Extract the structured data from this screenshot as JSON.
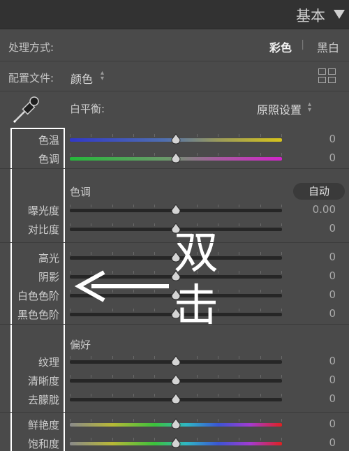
{
  "header": {
    "title": "基本",
    "collapse_icon": "triangle-down-icon"
  },
  "treatment": {
    "label": "处理方式:",
    "color_option": "彩色",
    "separator": "|",
    "bw_option": "黑白"
  },
  "profile": {
    "label": "配置文件:",
    "value": "颜色",
    "stepper": "⌃⌄",
    "browser_icon": "grid-icon"
  },
  "white_balance": {
    "icon": "eyedropper-icon",
    "label": "白平衡:",
    "value": "原照设置",
    "stepper": "⌃⌄"
  },
  "sliders_wb": [
    {
      "label": "色温",
      "value": "0",
      "level": 0.5,
      "gradient": "temp"
    },
    {
      "label": "色调",
      "value": "0",
      "level": 0.5,
      "gradient": "tint"
    }
  ],
  "tone": {
    "title": "色调",
    "auto_label": "自动",
    "sliders": [
      {
        "label": "曝光度",
        "value": "0.00",
        "level": 0.5
      },
      {
        "label": "对比度",
        "value": "0",
        "level": 0.5
      },
      {
        "label": "高光",
        "value": "0",
        "level": 0.5
      },
      {
        "label": "阴影",
        "value": "0",
        "level": 0.5
      },
      {
        "label": "白色色阶",
        "value": "0",
        "level": 0.5
      },
      {
        "label": "黑色色阶",
        "value": "0",
        "level": 0.5
      }
    ]
  },
  "presence": {
    "title": "偏好",
    "sliders": [
      {
        "label": "纹理",
        "value": "0",
        "level": 0.5
      },
      {
        "label": "清晰度",
        "value": "0",
        "level": 0.5
      },
      {
        "label": "去朦胧",
        "value": "0",
        "level": 0.5
      },
      {
        "label": "鲜艳度",
        "value": "0",
        "level": 0.5,
        "gradient": "rainbow"
      },
      {
        "label": "饱和度",
        "value": "0",
        "level": 0.5,
        "gradient": "rainbow"
      }
    ]
  },
  "annotation": {
    "text_line1": "双",
    "text_line2": "击",
    "arrow_direction": "left"
  }
}
